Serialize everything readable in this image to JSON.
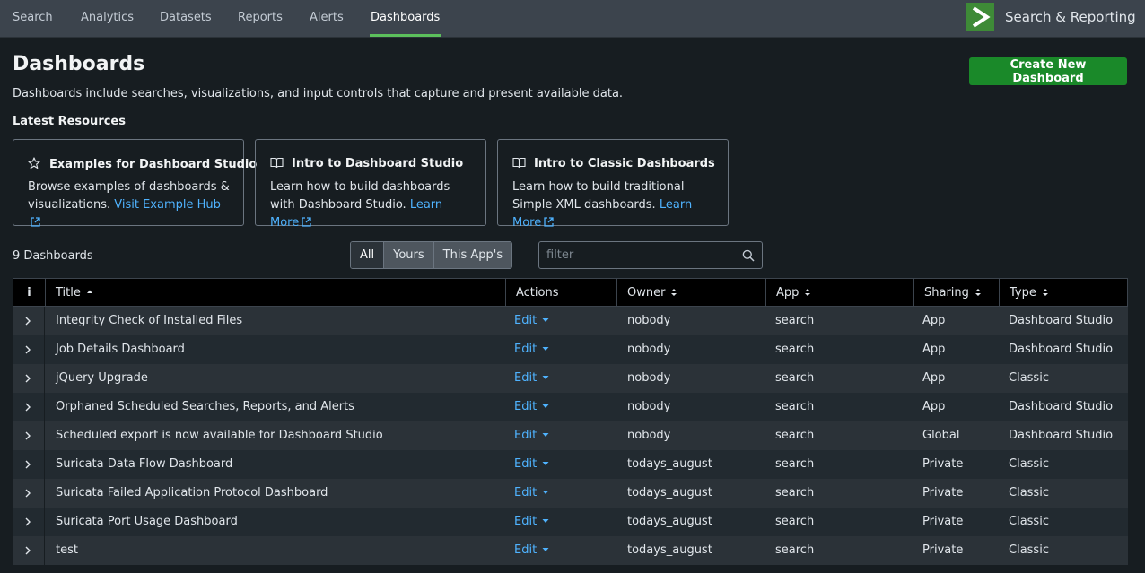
{
  "nav": {
    "tabs": [
      {
        "label": "Search"
      },
      {
        "label": "Analytics"
      },
      {
        "label": "Datasets"
      },
      {
        "label": "Reports"
      },
      {
        "label": "Alerts"
      },
      {
        "label": "Dashboards",
        "active": true
      }
    ],
    "app_title": "Search & Reporting"
  },
  "page": {
    "title": "Dashboards",
    "description": "Dashboards include searches, visualizations, and input controls that capture and present available data.",
    "create_button": "Create New Dashboard"
  },
  "latest_resources": {
    "title": "Latest Resources",
    "cards": [
      {
        "icon": "star-icon",
        "title": "Examples for Dashboard Studio",
        "text": "Browse examples of dashboards & visualizations.",
        "link": "Visit Example Hub"
      },
      {
        "icon": "book-icon",
        "title": "Intro to Dashboard Studio",
        "text": "Learn how to build dashboards with Dashboard Studio.",
        "link": "Learn More"
      },
      {
        "icon": "book-icon",
        "title": "Intro to Classic Dashboards",
        "text": "Learn how to build traditional Simple XML dashboards.",
        "link": "Learn More"
      }
    ]
  },
  "toolbar": {
    "count": "9 Dashboards",
    "filters": [
      "All",
      "Yours",
      "This App's"
    ],
    "selected_filter": "All",
    "filter_placeholder": "filter",
    "filter_value": ""
  },
  "table": {
    "columns": {
      "info": "i",
      "title": "Title",
      "actions": "Actions",
      "owner": "Owner",
      "app": "App",
      "sharing": "Sharing",
      "type": "Type"
    },
    "edit_label": "Edit",
    "rows": [
      {
        "title": "Integrity Check of Installed Files",
        "owner": "nobody",
        "app": "search",
        "sharing": "App",
        "type": "Dashboard Studio"
      },
      {
        "title": "Job Details Dashboard",
        "owner": "nobody",
        "app": "search",
        "sharing": "App",
        "type": "Dashboard Studio"
      },
      {
        "title": "jQuery Upgrade",
        "owner": "nobody",
        "app": "search",
        "sharing": "App",
        "type": "Classic"
      },
      {
        "title": "Orphaned Scheduled Searches, Reports, and Alerts",
        "owner": "nobody",
        "app": "search",
        "sharing": "App",
        "type": "Dashboard Studio"
      },
      {
        "title": "Scheduled export is now available for Dashboard Studio",
        "owner": "nobody",
        "app": "search",
        "sharing": "Global",
        "type": "Dashboard Studio"
      },
      {
        "title": "Suricata Data Flow Dashboard",
        "owner": "todays_august",
        "app": "search",
        "sharing": "Private",
        "type": "Classic"
      },
      {
        "title": "Suricata Failed Application Protocol Dashboard",
        "owner": "todays_august",
        "app": "search",
        "sharing": "Private",
        "type": "Classic"
      },
      {
        "title": "Suricata Port Usage Dashboard",
        "owner": "todays_august",
        "app": "search",
        "sharing": "Private",
        "type": "Classic"
      },
      {
        "title": "test",
        "owner": "todays_august",
        "app": "search",
        "sharing": "Private",
        "type": "Classic"
      }
    ]
  },
  "colors": {
    "accent_green": "#1a8929",
    "link_blue": "#4fb3ff",
    "active_tab_underline": "#5cc05c"
  }
}
